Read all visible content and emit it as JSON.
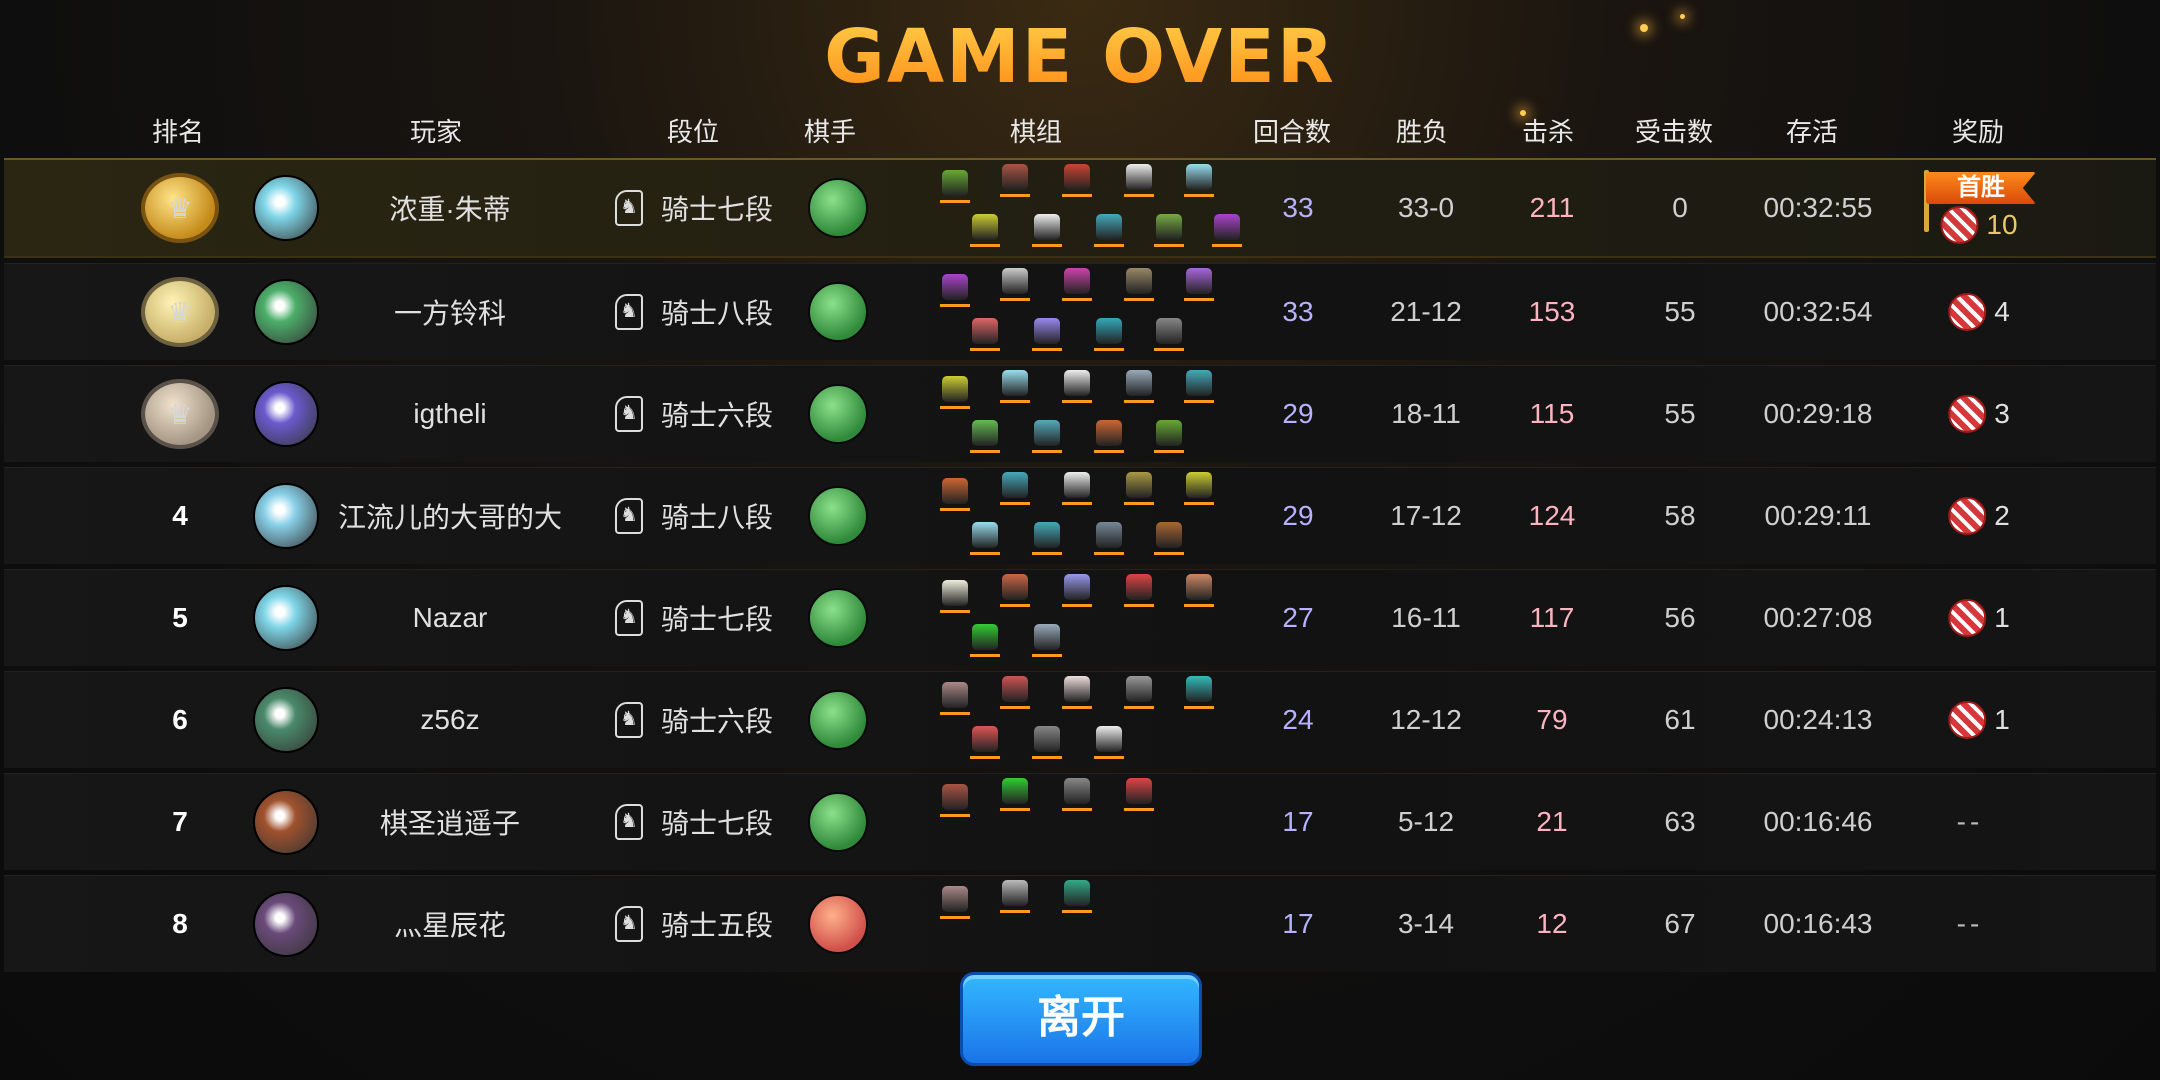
{
  "title": "GAME OVER",
  "headers": {
    "rank": "排名",
    "player": "玩家",
    "tier": "段位",
    "piece": "棋手",
    "lineup": "棋组",
    "rounds": "回合数",
    "winloss": "胜负",
    "kills": "击杀",
    "hits": "受击数",
    "survival": "存活",
    "reward": "奖励"
  },
  "first_win_label": "首胜",
  "rows": [
    {
      "rank": "",
      "medal": "gold",
      "name": "浓重·朱蒂",
      "tier": "骑士七段",
      "rounds": "33",
      "winloss": "33-0",
      "kills": "211",
      "hits": "0",
      "time": "00:32:55",
      "reward": "10",
      "first_win": true,
      "avatar": "#7fd6e8",
      "piece": "green",
      "chips": [
        "#6a3",
        "#a54",
        "#c43",
        "#eee",
        "#9de",
        "#cc3",
        "#eee",
        "#4ab",
        "#7a4",
        "#a4c"
      ]
    },
    {
      "rank": "",
      "medal": "silver",
      "name": "一方铃科",
      "tier": "骑士八段",
      "rounds": "33",
      "winloss": "21-12",
      "kills": "153",
      "hits": "55",
      "time": "00:32:54",
      "reward": "4",
      "avatar": "#4caf6a",
      "piece": "green",
      "chips": [
        "#a4c",
        "#ccc",
        "#c4a",
        "#986",
        "#a6d",
        "#d66",
        "#98e",
        "#3ab",
        "#888"
      ]
    },
    {
      "rank": "",
      "medal": "bronze",
      "name": "igtheli",
      "tier": "骑士六段",
      "rounds": "29",
      "winloss": "18-11",
      "kills": "115",
      "hits": "55",
      "time": "00:29:18",
      "reward": "3",
      "avatar": "#6a5acd",
      "piece": "green",
      "chips": [
        "#cc3",
        "#9de",
        "#eee",
        "#9ab",
        "#4ab",
        "#6b5",
        "#5ab",
        "#c63",
        "#6a3"
      ]
    },
    {
      "rank": "4",
      "medal": "",
      "name": "江流儿的大哥的大",
      "tier": "骑士八段",
      "rounds": "29",
      "winloss": "17-12",
      "kills": "124",
      "hits": "58",
      "time": "00:29:11",
      "reward": "2",
      "avatar": "#88d0e8",
      "piece": "green",
      "chips": [
        "#c63",
        "#4ab",
        "#eee",
        "#a94",
        "#cc3",
        "#9de",
        "#4ab",
        "#789",
        "#a63"
      ]
    },
    {
      "rank": "5",
      "medal": "",
      "name": "Nazar",
      "tier": "骑士七段",
      "rounds": "27",
      "winloss": "16-11",
      "kills": "117",
      "hits": "56",
      "time": "00:27:08",
      "reward": "1",
      "avatar": "#7fd6e8",
      "piece": "green",
      "chips": [
        "#eed",
        "#c64",
        "#99e",
        "#d44",
        "#c86",
        "#3c3",
        "#9ab"
      ]
    },
    {
      "rank": "6",
      "medal": "",
      "name": "z56z",
      "tier": "骑士六段",
      "rounds": "24",
      "winloss": "12-12",
      "kills": "79",
      "hits": "61",
      "time": "00:24:13",
      "reward": "1",
      "avatar": "#4a8a6a",
      "piece": "green",
      "chips": [
        "#a88",
        "#c55",
        "#edd",
        "#999",
        "#3bb",
        "#d55",
        "#888",
        "#eee"
      ]
    },
    {
      "rank": "7",
      "medal": "",
      "name": "棋圣逍遥子",
      "tier": "骑士七段",
      "rounds": "17",
      "winloss": "5-12",
      "kills": "21",
      "hits": "63",
      "time": "00:16:46",
      "reward": "--",
      "avatar": "#a0522d",
      "piece": "green",
      "chips": [
        "#a54",
        "#3c3",
        "#888",
        "#d44"
      ]
    },
    {
      "rank": "8",
      "medal": "",
      "name": "灬星辰花",
      "tier": "骑士五段",
      "rounds": "17",
      "winloss": "3-14",
      "kills": "12",
      "hits": "67",
      "time": "00:16:43",
      "reward": "--",
      "avatar": "#6a4a7a",
      "piece": "red",
      "chips": [
        "#a88",
        "#bbb",
        "#3a8"
      ]
    }
  ],
  "leave_button": "离开",
  "colors": {
    "title": "#ff9a1f",
    "button": "#1a8cff",
    "kills": "#ffb3c0",
    "rounds": "#b9b0ff"
  }
}
